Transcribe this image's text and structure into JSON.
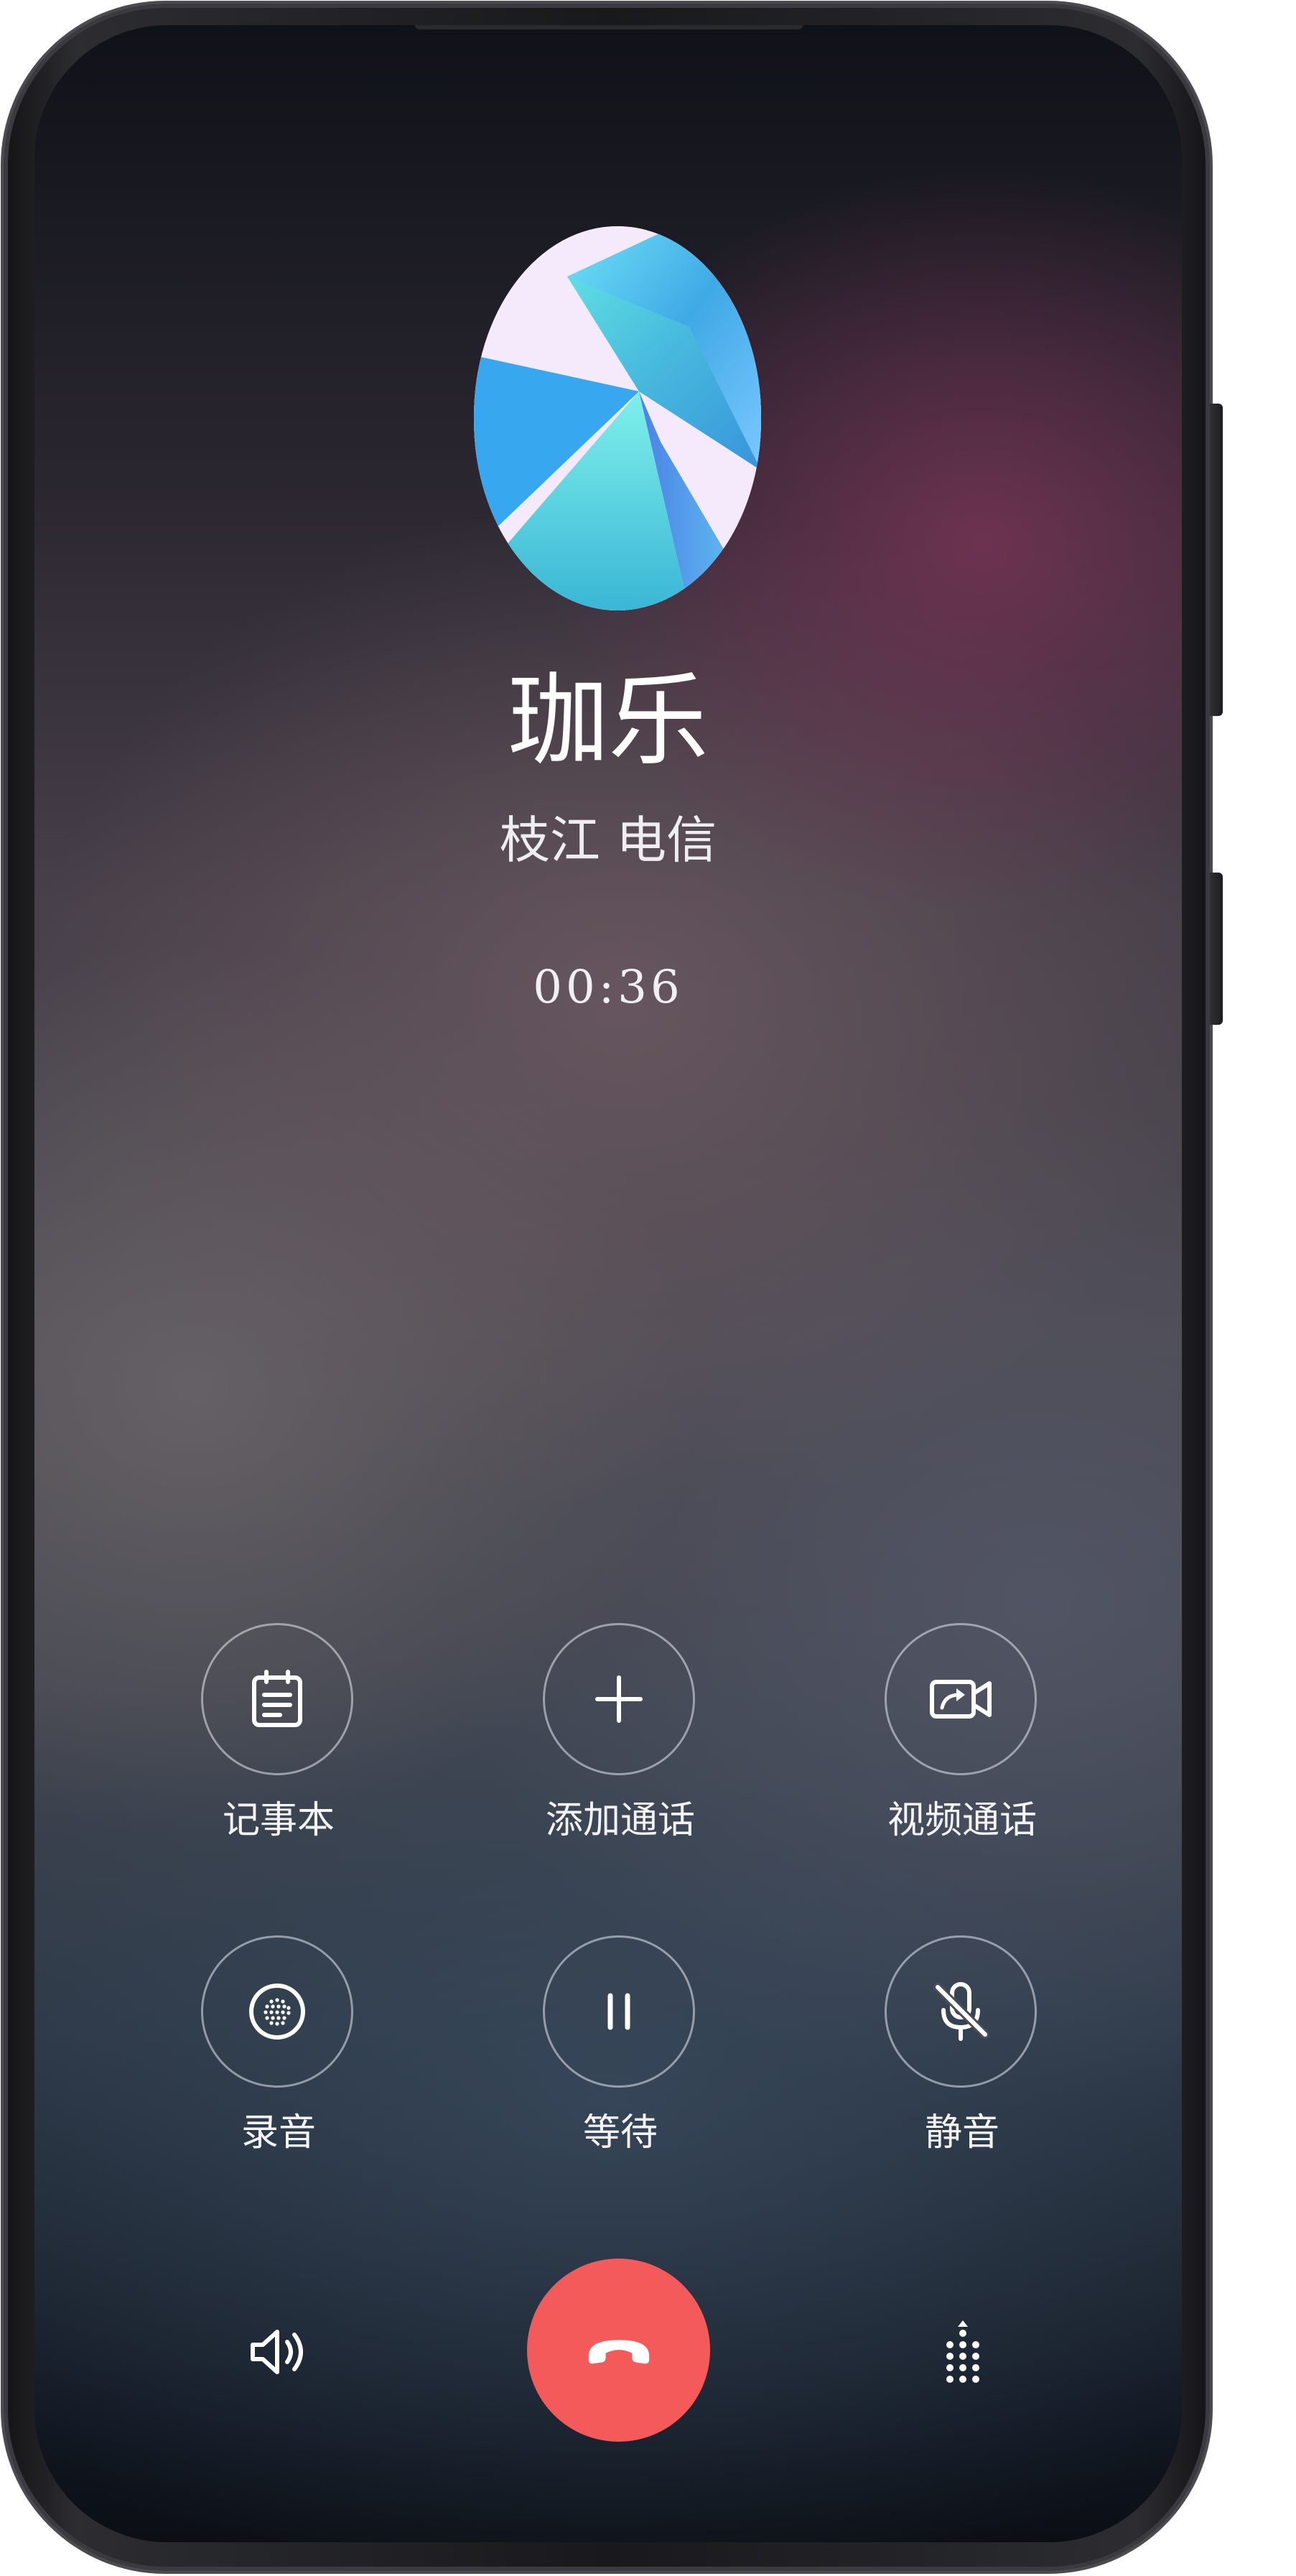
{
  "caller": {
    "name": "珈乐",
    "location": "枝江 电信",
    "duration": "00:36"
  },
  "actions": [
    {
      "label": "记事本",
      "icon": "notepad-icon"
    },
    {
      "label": "添加通话",
      "icon": "plus-icon"
    },
    {
      "label": "视频通话",
      "icon": "video-call-icon"
    },
    {
      "label": "录音",
      "icon": "record-icon"
    },
    {
      "label": "等待",
      "icon": "pause-icon"
    },
    {
      "label": "静音",
      "icon": "mic-off-icon"
    }
  ],
  "bottom_bar": {
    "speaker_icon": "speaker-icon",
    "end_call_icon": "hang-up-icon",
    "keypad_icon": "dialpad-icon"
  },
  "colors": {
    "end_call": "#f45a5a",
    "text": "#ffffff",
    "circle_border": "rgba(230,232,238,0.55)"
  }
}
